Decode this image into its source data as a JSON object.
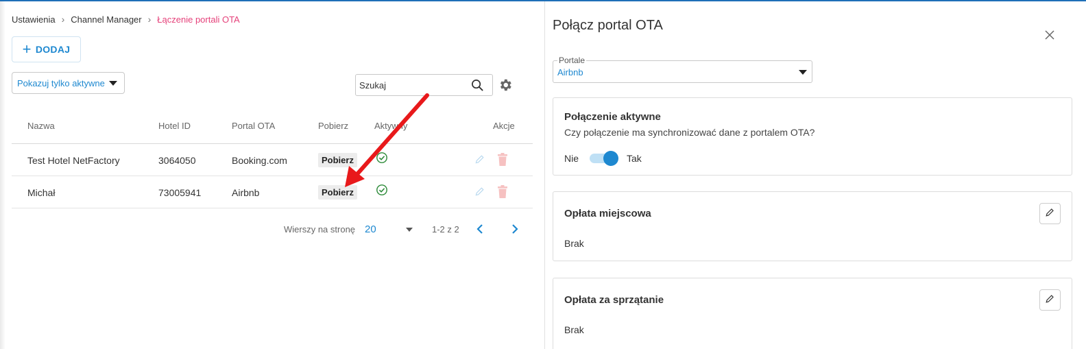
{
  "breadcrumb": {
    "items": [
      "Ustawienia",
      "Channel Manager"
    ],
    "current": "Łączenie portali OTA"
  },
  "toolbar": {
    "add_label": "DODAJ",
    "filter_label": "Pokazuj tylko aktywne",
    "search_placeholder": "Szukaj"
  },
  "table": {
    "headers": {
      "name": "Nazwa",
      "hotel_id": "Hotel ID",
      "portal": "Portal OTA",
      "fetch": "Pobierz",
      "active": "Aktywny",
      "actions": "Akcje"
    },
    "rows": [
      {
        "name": "Test Hotel NetFactory",
        "hotel_id": "3064050",
        "portal": "Booking.com",
        "fetch_label": "Pobierz",
        "active": true
      },
      {
        "name": "Michał",
        "hotel_id": "73005941",
        "portal": "Airbnb",
        "fetch_label": "Pobierz",
        "active": true
      }
    ]
  },
  "pagination": {
    "rows_per_page_label": "Wierszy na stronę",
    "rows_per_page": "20",
    "range": "1-2 z 2"
  },
  "panel": {
    "title": "Połącz portal OTA",
    "portal_field": {
      "label": "Portale",
      "value": "Airbnb"
    },
    "connection": {
      "title": "Połączenie aktywne",
      "question": "Czy połączenie ma synchronizować dane z portalem OTA?",
      "off_label": "Nie",
      "on_label": "Tak",
      "enabled": true
    },
    "local_fee": {
      "title": "Opłata miejscowa",
      "value": "Brak"
    },
    "cleaning_fee": {
      "title": "Opłata za sprzątanie",
      "value": "Brak"
    }
  },
  "colors": {
    "accent": "#1e88d0",
    "breadcrumb_active": "#e5417a",
    "success": "#2e8b3a",
    "annotation_arrow": "#e8191b"
  }
}
